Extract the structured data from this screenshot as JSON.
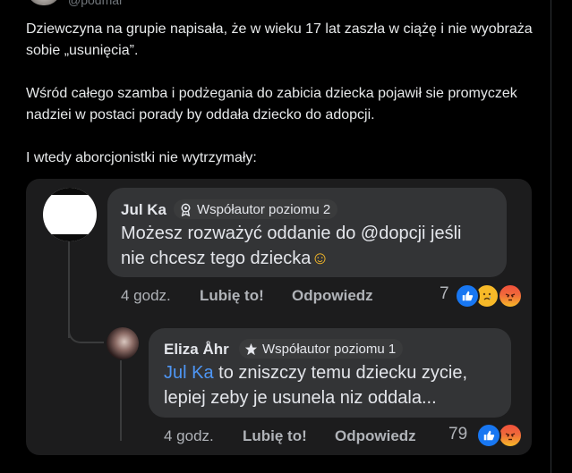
{
  "post": {
    "handle": "@podmar",
    "paragraphs": [
      "Dziewczyna na grupie napisała, że w wieku 17 lat zaszła w ciążę i nie wyobraża sobie „usunięcia”.",
      "Wśród całego szamba i podżegania do zabicia dziecka pojawił sie promyczek nadziei w postaci porady by oddała dziecko do adopcji.",
      "I wtedy aborcjonistki nie wytrzymały:"
    ]
  },
  "comments": [
    {
      "author": "Jul Ka",
      "badge": "Współautor poziomu 2",
      "line1": "Możesz rozważyć oddanie do @dopcji jeśli",
      "line2": "nie chcesz tego dziecka",
      "emoji": "☺",
      "time": "4 godz.",
      "like_label": "Lubię to!",
      "reply_label": "Odpowiedz",
      "reactions_count": "7",
      "reactions": [
        "like",
        "sad",
        "angry"
      ]
    },
    {
      "author": "Eliza Åhr",
      "badge": "Współautor poziomu 1",
      "mention": "Jul Ka",
      "line1": " to zniszczy temu dziecku zycie,",
      "line2": "lepiej zeby je usunela niz oddala...",
      "time": "4 godz.",
      "like_label": "Lubię to!",
      "reply_label": "Odpowiedz",
      "reactions_count": "79",
      "reactions": [
        "like",
        "angry"
      ]
    }
  ]
}
